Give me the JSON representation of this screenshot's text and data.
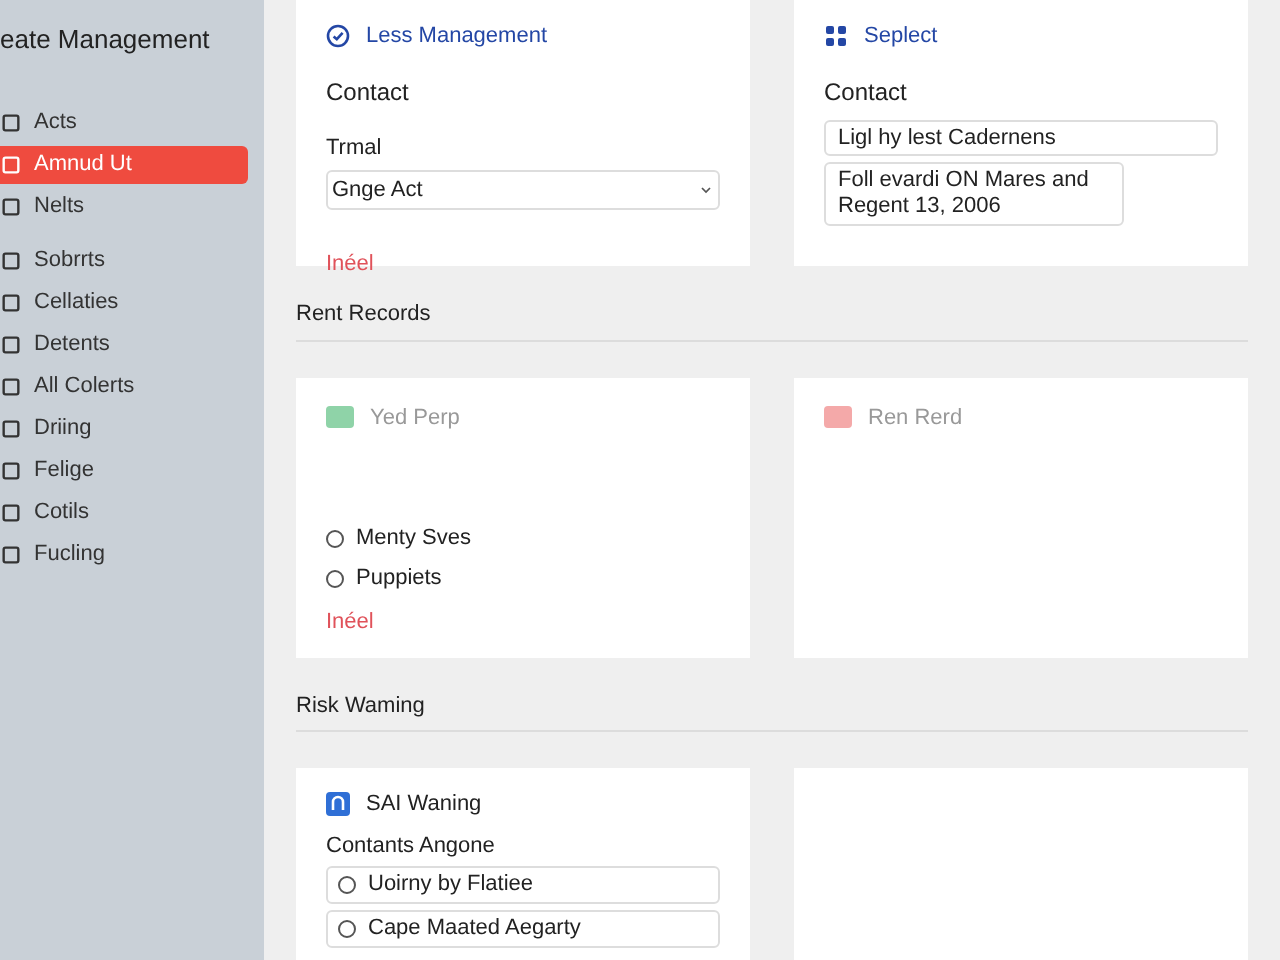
{
  "sidebar": {
    "title": "eate Management",
    "items": [
      {
        "label": "Acts",
        "selected": false
      },
      {
        "label": "Amnud Ut",
        "selected": true
      },
      {
        "label": "Nelts",
        "selected": false
      },
      {
        "label": "Sobrrts",
        "selected": false
      },
      {
        "label": "Cellaties",
        "selected": false
      },
      {
        "label": "Detents",
        "selected": false
      },
      {
        "label": "All Colerts",
        "selected": false
      },
      {
        "label": "Driing",
        "selected": false
      },
      {
        "label": "Felige",
        "selected": false
      },
      {
        "label": "Cotils",
        "selected": false
      },
      {
        "label": "Fucling",
        "selected": false
      }
    ]
  },
  "top_cards": [
    {
      "kind": "select",
      "title": "Less Management",
      "heading": "Contact",
      "field_label": "Trmal",
      "value": "Gnge Act",
      "link": "Inéel"
    },
    {
      "kind": "text",
      "title": "Seplect",
      "heading": "Contact",
      "input_value": "Ligl hy lest Cadernens",
      "textarea_value": "Foll evardi ON Mares and Regent 13, 2006"
    }
  ],
  "rent_records": {
    "title": "Rent Records",
    "cards": [
      {
        "title": "Yed Perp",
        "color": "#8fd3a8",
        "options": [
          {
            "label": "Menty Sves",
            "selected": false
          },
          {
            "label": "Puppiets",
            "selected": false
          }
        ],
        "link": "Inéel"
      },
      {
        "title": "Ren Rerd",
        "color": "#f4a9a9"
      }
    ]
  },
  "risk_warning": {
    "title": "Risk Waming",
    "card": {
      "title": "SAI Waning",
      "heading": "Contants Angone",
      "options": [
        {
          "label": "Uoirny by Flatiee",
          "selected": false
        },
        {
          "label": "Cape Maated Aegarty",
          "selected": false
        }
      ]
    }
  }
}
